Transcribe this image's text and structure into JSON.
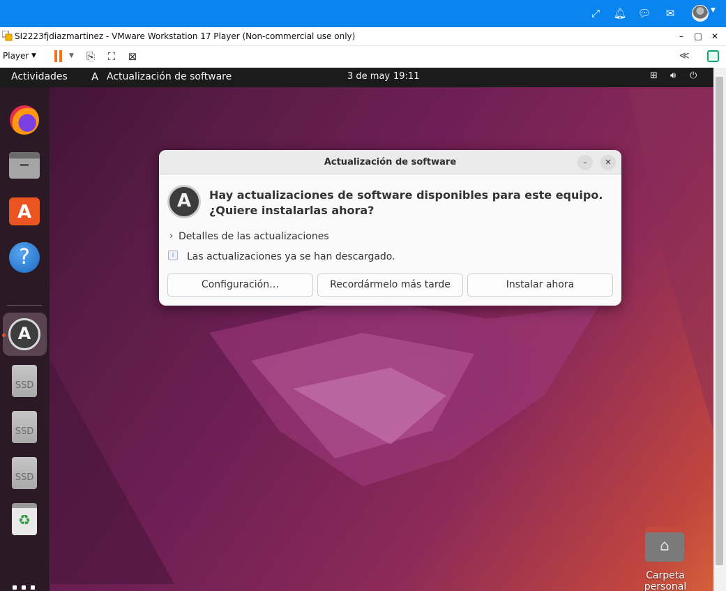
{
  "host": {
    "icons": [
      "expand-icon",
      "bell-icon",
      "chat-icon",
      "mail-icon"
    ],
    "accent": "#0a84ef"
  },
  "vmware": {
    "title": "SI2223fjdiazmartinez - VMware Workstation 17 Player (Non-commercial use only)",
    "player_menu": "Player",
    "window_controls": {
      "minimize": "–",
      "maximize": "□",
      "close": "✕"
    },
    "pause_color": "#f27421"
  },
  "gnome": {
    "activities": "Actividades",
    "app_menu": "Actualización de software",
    "date": "3 de may",
    "time": "19:11"
  },
  "dock": {
    "ssd_label": "SSD"
  },
  "dialog": {
    "title": "Actualización de software",
    "heading_line1": "Hay actualizaciones de software disponibles para este equipo.",
    "heading_line2": "¿Quiere instalarlas ahora?",
    "details_label": "Detalles de las actualizaciones",
    "info_text": "Las actualizaciones ya se han descargado.",
    "buttons": {
      "settings": "Configuración…",
      "remind": "Recordármelo más tarde",
      "install": "Instalar ahora"
    }
  },
  "desktop": {
    "home_label": "Carpeta personal"
  }
}
